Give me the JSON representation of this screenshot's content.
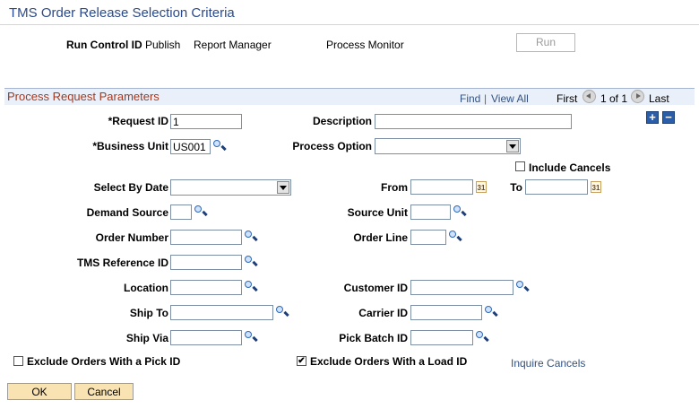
{
  "page": {
    "title": "TMS Order Release Selection Criteria"
  },
  "run_control": {
    "label": "Run Control ID",
    "publish": "Publish",
    "report_manager": "Report Manager",
    "process_monitor": "Process Monitor",
    "run_button": "Run"
  },
  "group": {
    "title": "Process Request Parameters",
    "find": "Find",
    "separator": "|",
    "view_all": "View All",
    "first": "First",
    "counter": "1 of 1",
    "last": "Last",
    "add_symbol": "+",
    "remove_symbol": "−"
  },
  "fields": {
    "request_id": {
      "label": "*Request ID",
      "value": "1"
    },
    "description": {
      "label": "Description",
      "value": ""
    },
    "business_unit": {
      "label": "*Business Unit",
      "value": "US001"
    },
    "process_option": {
      "label": "Process Option",
      "value": ""
    },
    "include_cancels": {
      "label": "Include Cancels",
      "checked": false
    },
    "select_by_date": {
      "label": "Select By Date",
      "value": ""
    },
    "from": {
      "label": "From",
      "value": ""
    },
    "to": {
      "label": "To",
      "value": ""
    },
    "demand_source": {
      "label": "Demand Source",
      "value": ""
    },
    "source_unit": {
      "label": "Source Unit",
      "value": ""
    },
    "order_number": {
      "label": "Order Number",
      "value": ""
    },
    "order_line": {
      "label": "Order Line",
      "value": ""
    },
    "tms_reference_id": {
      "label": "TMS Reference ID",
      "value": ""
    },
    "location": {
      "label": "Location",
      "value": ""
    },
    "customer_id": {
      "label": "Customer ID",
      "value": ""
    },
    "ship_to": {
      "label": "Ship To",
      "value": ""
    },
    "carrier_id": {
      "label": "Carrier ID",
      "value": ""
    },
    "ship_via": {
      "label": "Ship Via",
      "value": ""
    },
    "pick_batch_id": {
      "label": "Pick Batch ID",
      "value": ""
    },
    "exclude_pick": {
      "label": "Exclude Orders With a Pick ID",
      "checked": false
    },
    "exclude_load": {
      "label": "Exclude Orders With a Load ID",
      "checked": true,
      "mark": "✔"
    },
    "inquire_cancels": "Inquire Cancels"
  },
  "calendar_glyph": "31",
  "footer": {
    "ok": "OK",
    "cancel": "Cancel"
  }
}
